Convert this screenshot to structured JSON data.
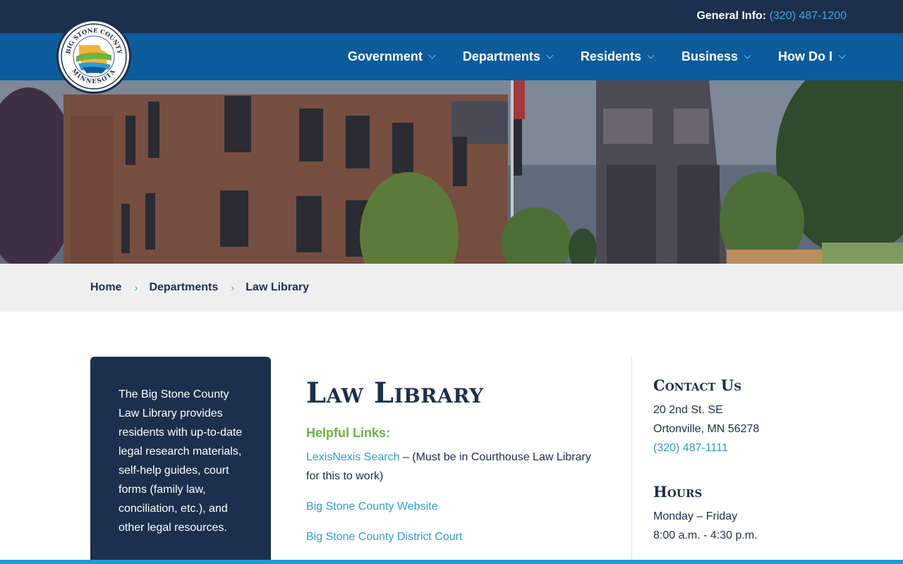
{
  "topbar": {
    "label": "General Info:",
    "phone": "(320) 487-1200"
  },
  "logo": {
    "top_text": "BIG STONE COUNTY",
    "bottom_text": "MINNESOTA"
  },
  "nav": {
    "items": [
      {
        "label": "Government"
      },
      {
        "label": "Departments"
      },
      {
        "label": "Residents"
      },
      {
        "label": "Business"
      },
      {
        "label": "How Do I"
      }
    ]
  },
  "breadcrumb": {
    "items": [
      "Home",
      "Departments",
      "Law Library"
    ]
  },
  "intro": {
    "text": "The Big Stone County Law Library provides residents with up-to-date legal research materials, self-help guides, court forms (family law, conciliation, etc.), and other legal resources."
  },
  "main": {
    "title": "Law Library",
    "links_heading": "Helpful Links:",
    "lexis_link": "LexisNexis Search",
    "lexis_note": " – (Must be in Courthouse Law Library for this to work)",
    "county_link": "Big Stone County Website",
    "court_link": "Big Stone County District Court"
  },
  "contact": {
    "heading": "Contact Us",
    "address1": "20 2nd St. SE",
    "address2": "Ortonville, MN 56278",
    "phone": "(320) 487-1111"
  },
  "hours": {
    "heading": "Hours",
    "days": "Monday – Friday",
    "time": "8:00 a.m. - 4:30 p.m."
  },
  "colors": {
    "navy": "#1c2f4d",
    "nav_blue": "#0c5c9c",
    "link_blue": "#2f9ccf",
    "green": "#6cb33f"
  }
}
